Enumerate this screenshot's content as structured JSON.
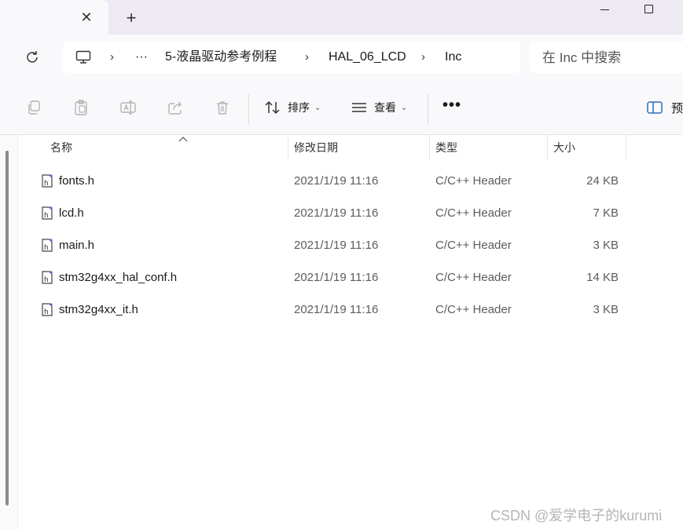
{
  "tab": {
    "close_glyph": "✕",
    "new_tab_glyph": "+"
  },
  "address": {
    "overflow": "···",
    "crumbs": [
      "5-液晶驱动参考例程",
      "HAL_06_LCD",
      "Inc"
    ],
    "chevron": "›"
  },
  "search": {
    "placeholder": "在 Inc 中搜索"
  },
  "toolbar": {
    "sort_label": "排序",
    "view_label": "查看",
    "more_label": "•••",
    "preview_label": "预"
  },
  "columns": {
    "name": "名称",
    "modified": "修改日期",
    "type": "类型",
    "size": "大小"
  },
  "files": [
    {
      "name": "fonts.h",
      "modified": "2021/1/19 11:16",
      "type": "C/C++ Header",
      "size": "24 KB"
    },
    {
      "name": "lcd.h",
      "modified": "2021/1/19 11:16",
      "type": "C/C++ Header",
      "size": "7 KB"
    },
    {
      "name": "main.h",
      "modified": "2021/1/19 11:16",
      "type": "C/C++ Header",
      "size": "3 KB"
    },
    {
      "name": "stm32g4xx_hal_conf.h",
      "modified": "2021/1/19 11:16",
      "type": "C/C++ Header",
      "size": "14 KB"
    },
    {
      "name": "stm32g4xx_it.h",
      "modified": "2021/1/19 11:16",
      "type": "C/C++ Header",
      "size": "3 KB"
    }
  ],
  "watermark": "CSDN @爱学电子的kurumi",
  "colors": {
    "titlebar": "#eeeaf3",
    "chrome": "#f9f8fb",
    "file_icon_accent": "#7a3fc9"
  }
}
